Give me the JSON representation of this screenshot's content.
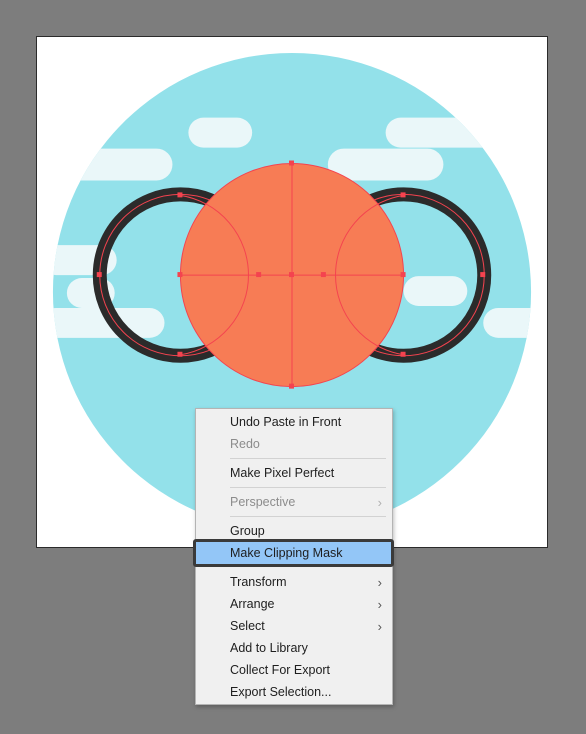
{
  "canvas": {
    "artboard_label": "artboard",
    "colors": {
      "background": "#7d7d7d",
      "sky": "#93e1ea",
      "cloud": "#eaf7f9",
      "ring": "#2b2b2b",
      "ball": "#f77c55",
      "selection": "#f4434f"
    }
  },
  "context_menu": {
    "items": [
      {
        "label": "Undo Paste in Front",
        "enabled": true,
        "submenu": false
      },
      {
        "label": "Redo",
        "enabled": false,
        "submenu": false
      },
      {
        "label": "Make Pixel Perfect",
        "enabled": true,
        "submenu": false
      },
      {
        "label": "Perspective",
        "enabled": false,
        "submenu": true
      },
      {
        "label": "Group",
        "enabled": true,
        "submenu": false
      },
      {
        "label": "Make Clipping Mask",
        "enabled": true,
        "submenu": false,
        "highlighted": true
      },
      {
        "label": "Transform",
        "enabled": true,
        "submenu": true
      },
      {
        "label": "Arrange",
        "enabled": true,
        "submenu": true
      },
      {
        "label": "Select",
        "enabled": true,
        "submenu": true
      },
      {
        "label": "Add to Library",
        "enabled": true,
        "submenu": false
      },
      {
        "label": "Collect For Export",
        "enabled": true,
        "submenu": false
      },
      {
        "label": "Export Selection...",
        "enabled": true,
        "submenu": false
      }
    ],
    "submenu_glyph": "›"
  }
}
